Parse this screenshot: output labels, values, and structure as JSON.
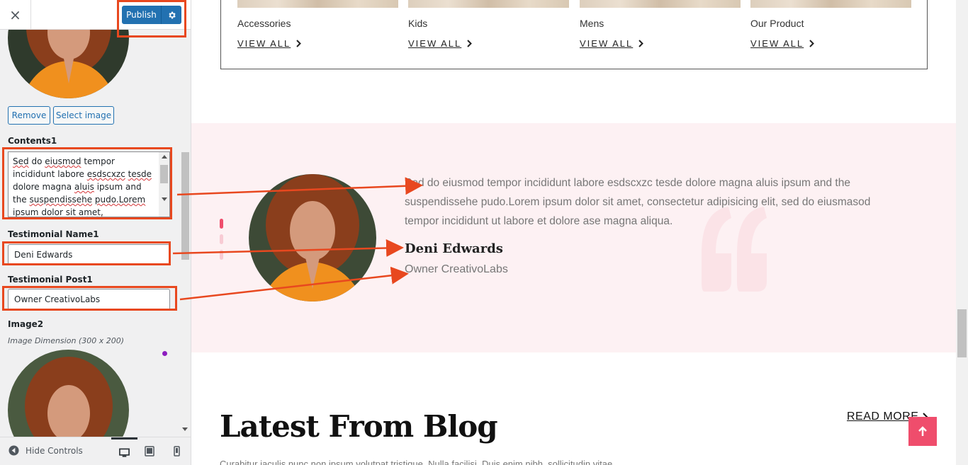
{
  "panel": {
    "close_icon": "×",
    "publish_label": "Publish",
    "remove_label": "Remove",
    "select_image_label": "Select image",
    "contents_label": "Contents1",
    "contents_words": [
      "Sed",
      "do",
      "eiusmod",
      "tempor",
      "incididunt",
      "labore",
      "esdscxzc",
      "tesde",
      "dolore",
      "magna",
      "aluis",
      "ipsum",
      "and",
      "the",
      "suspendissehe",
      "pudo.Lorem",
      "ipsum",
      "dolor",
      "sit",
      "amet,",
      "consectetur"
    ],
    "name_label": "Testimonial Name1",
    "name_value": "Deni Edwards",
    "post_label": "Testimonial Post1",
    "post_value": "Owner CreativoLabs",
    "image2_label": "Image2",
    "image2_hint": "Image Dimension (300 x 200)",
    "hide_controls_label": "Hide Controls",
    "devices": [
      "desktop-icon",
      "tablet-icon",
      "mobile-icon"
    ]
  },
  "preview": {
    "categories": [
      {
        "title": "Accessories",
        "link": "VIEW ALL"
      },
      {
        "title": "Kids",
        "link": "VIEW ALL"
      },
      {
        "title": "Mens",
        "link": "VIEW ALL"
      },
      {
        "title": "Our Product",
        "link": "VIEW ALL"
      }
    ],
    "testimonial": {
      "text": "Sed do eiusmod tempor incididunt labore esdscxzc tesde dolore magna aluis ipsum and the suspendissehe pudo.Lorem ipsum dolor sit amet, consectetur adipisicing elit, sed do eiusmasod tempor incididunt ut labore et dolore ase magna aliqua.",
      "name": "Deni Edwards",
      "post": "Owner CreativoLabs"
    },
    "blog_title": "Latest From Blog",
    "read_more": "READ MORE",
    "blog_subtitle": "Curabitur iaculis nunc non ipsum volutpat tristique. Nulla facilisi. Duis enim nibh, sollicitudin vitae"
  },
  "colors": {
    "accent": "#2271b1",
    "highlight": "#e8481f",
    "pink": "#ef4d6c",
    "section_bg": "#fdf1f3"
  }
}
